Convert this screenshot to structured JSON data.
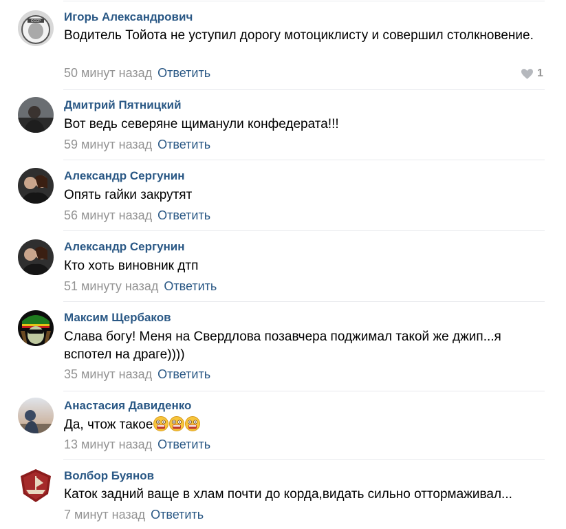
{
  "colors": {
    "author_link": "#2a5885",
    "meta_gray": "#939393",
    "divider": "#e7e8ec",
    "text": "#000000"
  },
  "comments": [
    {
      "author": "Игорь Александрович",
      "avatar_icon": "astronaut-helmet-avatar",
      "text": "Водитель Тойота не уступил дорогу мотоциклисту и совершил столкновение.",
      "time": "50 минут назад",
      "reply_label": "Ответить",
      "likes": "1",
      "like_icon": "heart-icon"
    },
    {
      "author": "Дмитрий Пятницкий",
      "avatar_icon": "person-photo-avatar",
      "text": "Вот ведь северяне щиманули конфедерата!!!",
      "time": "59 минут назад",
      "reply_label": "Ответить"
    },
    {
      "author": "Александр Сергунин",
      "avatar_icon": "couple-photo-avatar",
      "text": "Опять гайки закрутят",
      "time": "56 минут назад",
      "reply_label": "Ответить"
    },
    {
      "author": "Александр Сергунин",
      "avatar_icon": "couple-photo-avatar",
      "text": "Кто хоть виновник дтп",
      "time": "51 минуту назад",
      "reply_label": "Ответить"
    },
    {
      "author": "Максим Щербаков",
      "avatar_icon": "skull-rasta-avatar",
      "text": "Слава богу! Меня на Свердлова позавчера поджимал такой же джип...я вспотел на драге))))",
      "time": "35 минут назад",
      "reply_label": "Ответить"
    },
    {
      "author": "Анастасия Давиденко",
      "avatar_icon": "sunset-photo-avatar",
      "text": "Да, чтож такое",
      "emoji_icons": [
        "shocked-face-emoji",
        "shocked-face-emoji",
        "shocked-face-emoji"
      ],
      "time": "13 минут назад",
      "reply_label": "Ответить"
    },
    {
      "author": "Волбор Буянов",
      "avatar_icon": "viking-ship-shield-avatar",
      "text": "Каток задний ваще в хлам почти до корда,видать сильно оттормаживал...",
      "time": "7 минут назад",
      "reply_label": "Ответить"
    }
  ]
}
